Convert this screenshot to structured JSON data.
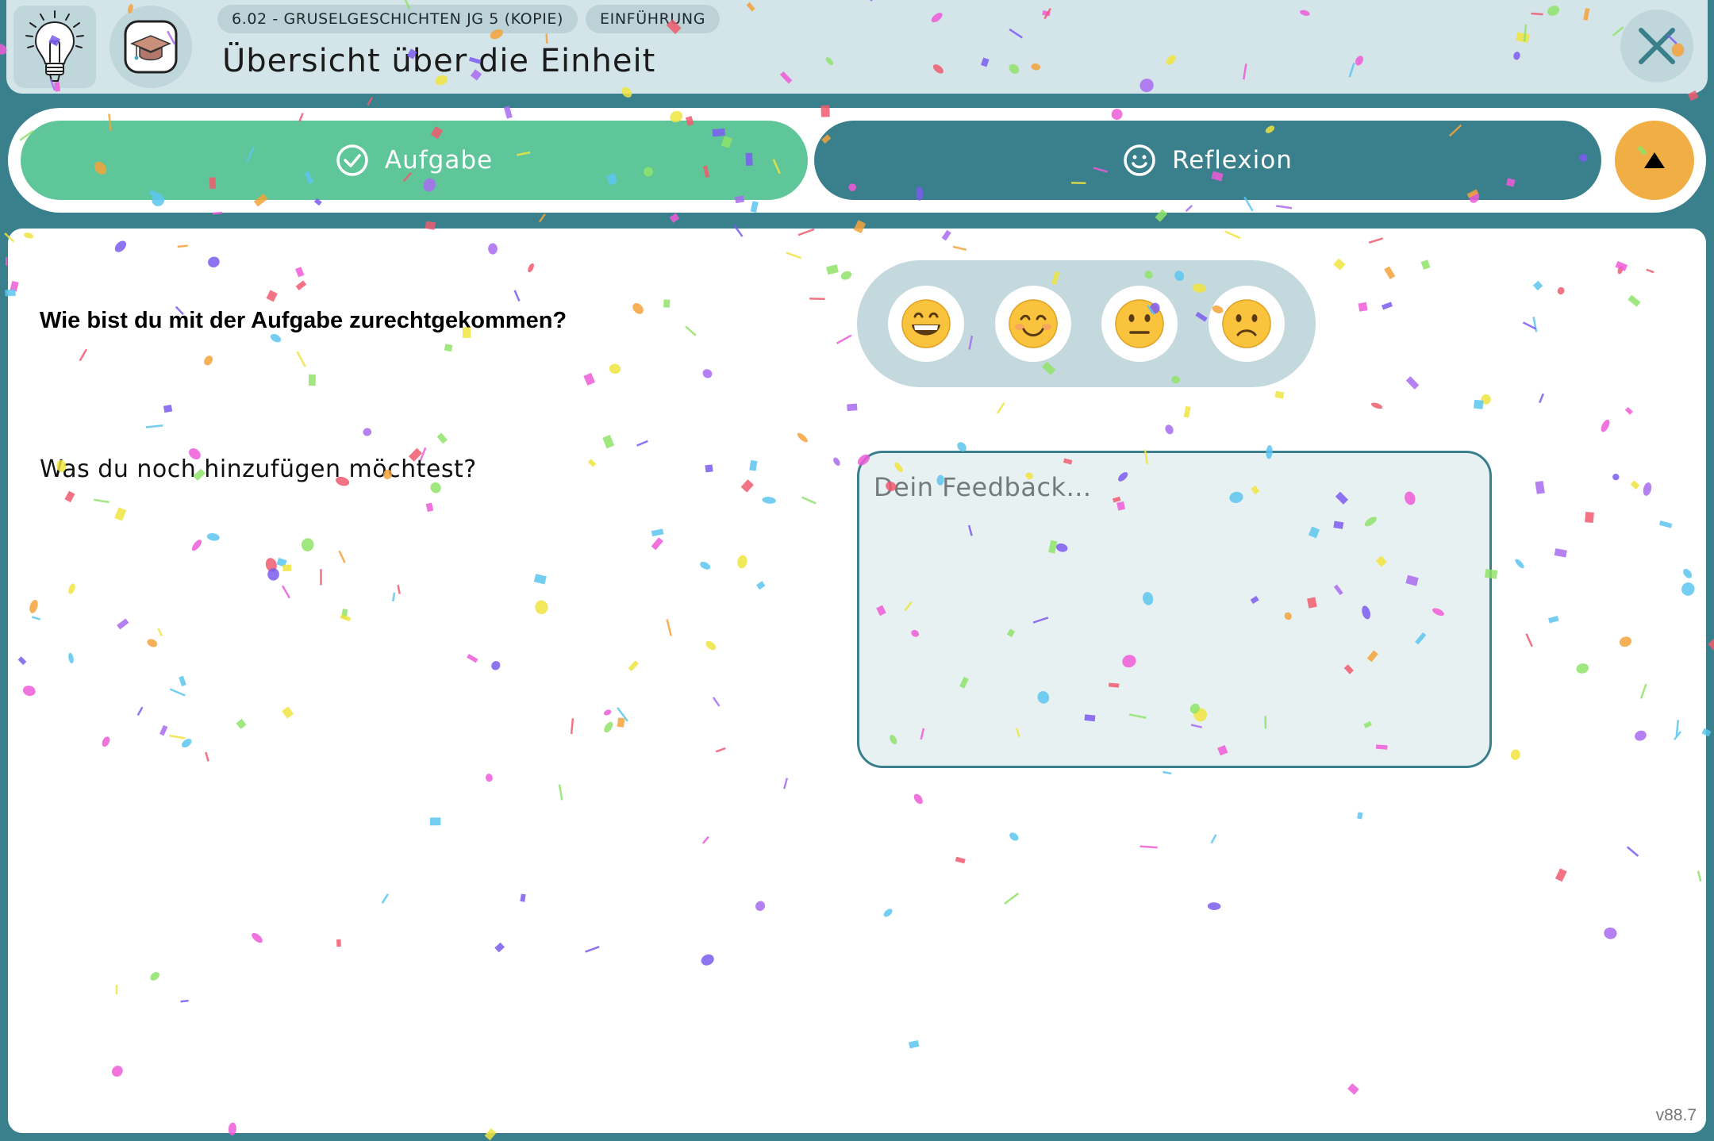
{
  "header": {
    "tags": [
      "6.02 - GRUSELGESCHICHTEN JG 5 (KOPIE)",
      "EINFÜHRUNG"
    ],
    "title": "Übersicht über die Einheit"
  },
  "icons": {
    "app": "lightbulb-icon",
    "course": "graduation-cap-icon",
    "close": "close-icon",
    "collapse": "triangle-up-icon"
  },
  "tabs": [
    {
      "label": "Aufgabe",
      "icon": "check-circle-icon",
      "color": "#5fc699"
    },
    {
      "label": "Reflexion",
      "icon": "smiley-icon",
      "color": "#3a7f8c"
    }
  ],
  "reflection": {
    "question_1": "Wie bist du mit der Aufgabe zurechtgekommen?",
    "question_2": "Was du noch hinzufügen möchtest?",
    "ratings": [
      "very-happy",
      "happy",
      "neutral",
      "sad"
    ],
    "feedback": {
      "value": "",
      "placeholder": "Dein Feedback..."
    }
  },
  "version": "v88.7",
  "colors": {
    "background": "#3a7f8c",
    "accent_green": "#5fc699",
    "accent_orange": "#f0ae45",
    "header_bg": "#d3e5e8"
  }
}
